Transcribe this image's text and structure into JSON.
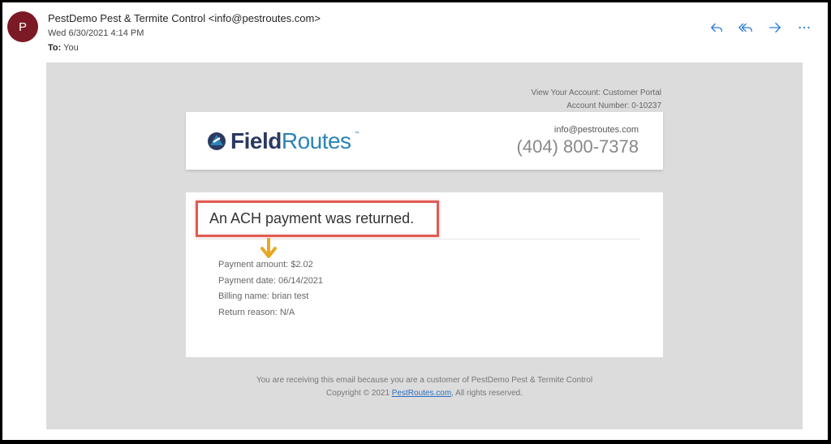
{
  "header": {
    "avatar_initial": "P",
    "sender": "PestDemo Pest & Termite Control <info@pestroutes.com>",
    "date": "Wed 6/30/2021 4:14 PM",
    "to_label": "To:",
    "to_value": "You",
    "actions": [
      "reply-icon",
      "reply-all-icon",
      "forward-icon",
      "more-icon"
    ],
    "accent_color": "#2b7cd3",
    "avatar_color": "#7b1a24"
  },
  "email": {
    "portal_link": "View Your Account: Customer Portal",
    "account_number": "Account Number: 0-10237",
    "logo": {
      "field": "Field",
      "routes": "Routes",
      "tm": "™"
    },
    "contact_email": "info@pestroutes.com",
    "contact_phone": "(404) 800-7378",
    "headline": "An ACH payment was returned.",
    "details": {
      "amount": "Payment amount: $2.02",
      "date": "Payment date: 06/14/2021",
      "billing_name": "Billing name: brian test",
      "return_reason": "Return reason: N/A"
    },
    "footer": {
      "notice": "You are receiving this email because you are a customer of PestDemo Pest & Termite Control",
      "copyright_prefix": "Copyright © 2021",
      "link": "PestRoutes.com",
      "copyright_suffix": ", All rights reserved."
    }
  }
}
